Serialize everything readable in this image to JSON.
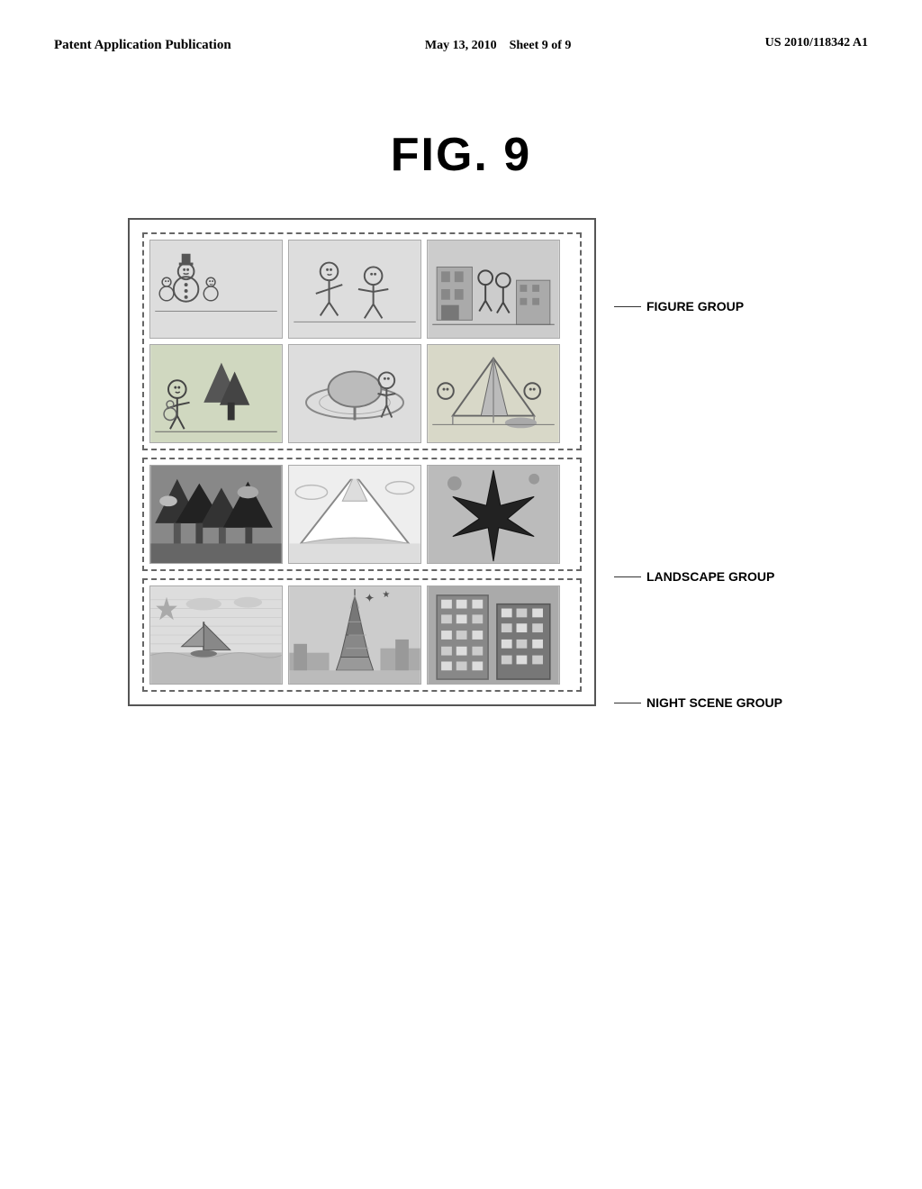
{
  "header": {
    "left": "Patent Application Publication",
    "center_date": "May 13, 2010",
    "center_sheet": "Sheet 9 of 9",
    "right": "US 2010/118342 A1"
  },
  "figure": {
    "title": "FIG. 9"
  },
  "groups": {
    "figure_group": "FIGURE GROUP",
    "landscape_group": "LANDSCAPE GROUP",
    "night_scene_group": "NIGHT SCENE GROUP"
  },
  "thumbnails": {
    "row1": [
      "snowmen-figures",
      "figures-sitting",
      "figures-at-monument"
    ],
    "row2": [
      "figures-outdoors",
      "figures-spinning-top",
      "figures-tent"
    ],
    "row3": [
      "forest-landscape",
      "mountain-landscape",
      "star-landscape"
    ],
    "row4": [
      "night-sailboat",
      "night-eiffel",
      "night-building"
    ]
  }
}
